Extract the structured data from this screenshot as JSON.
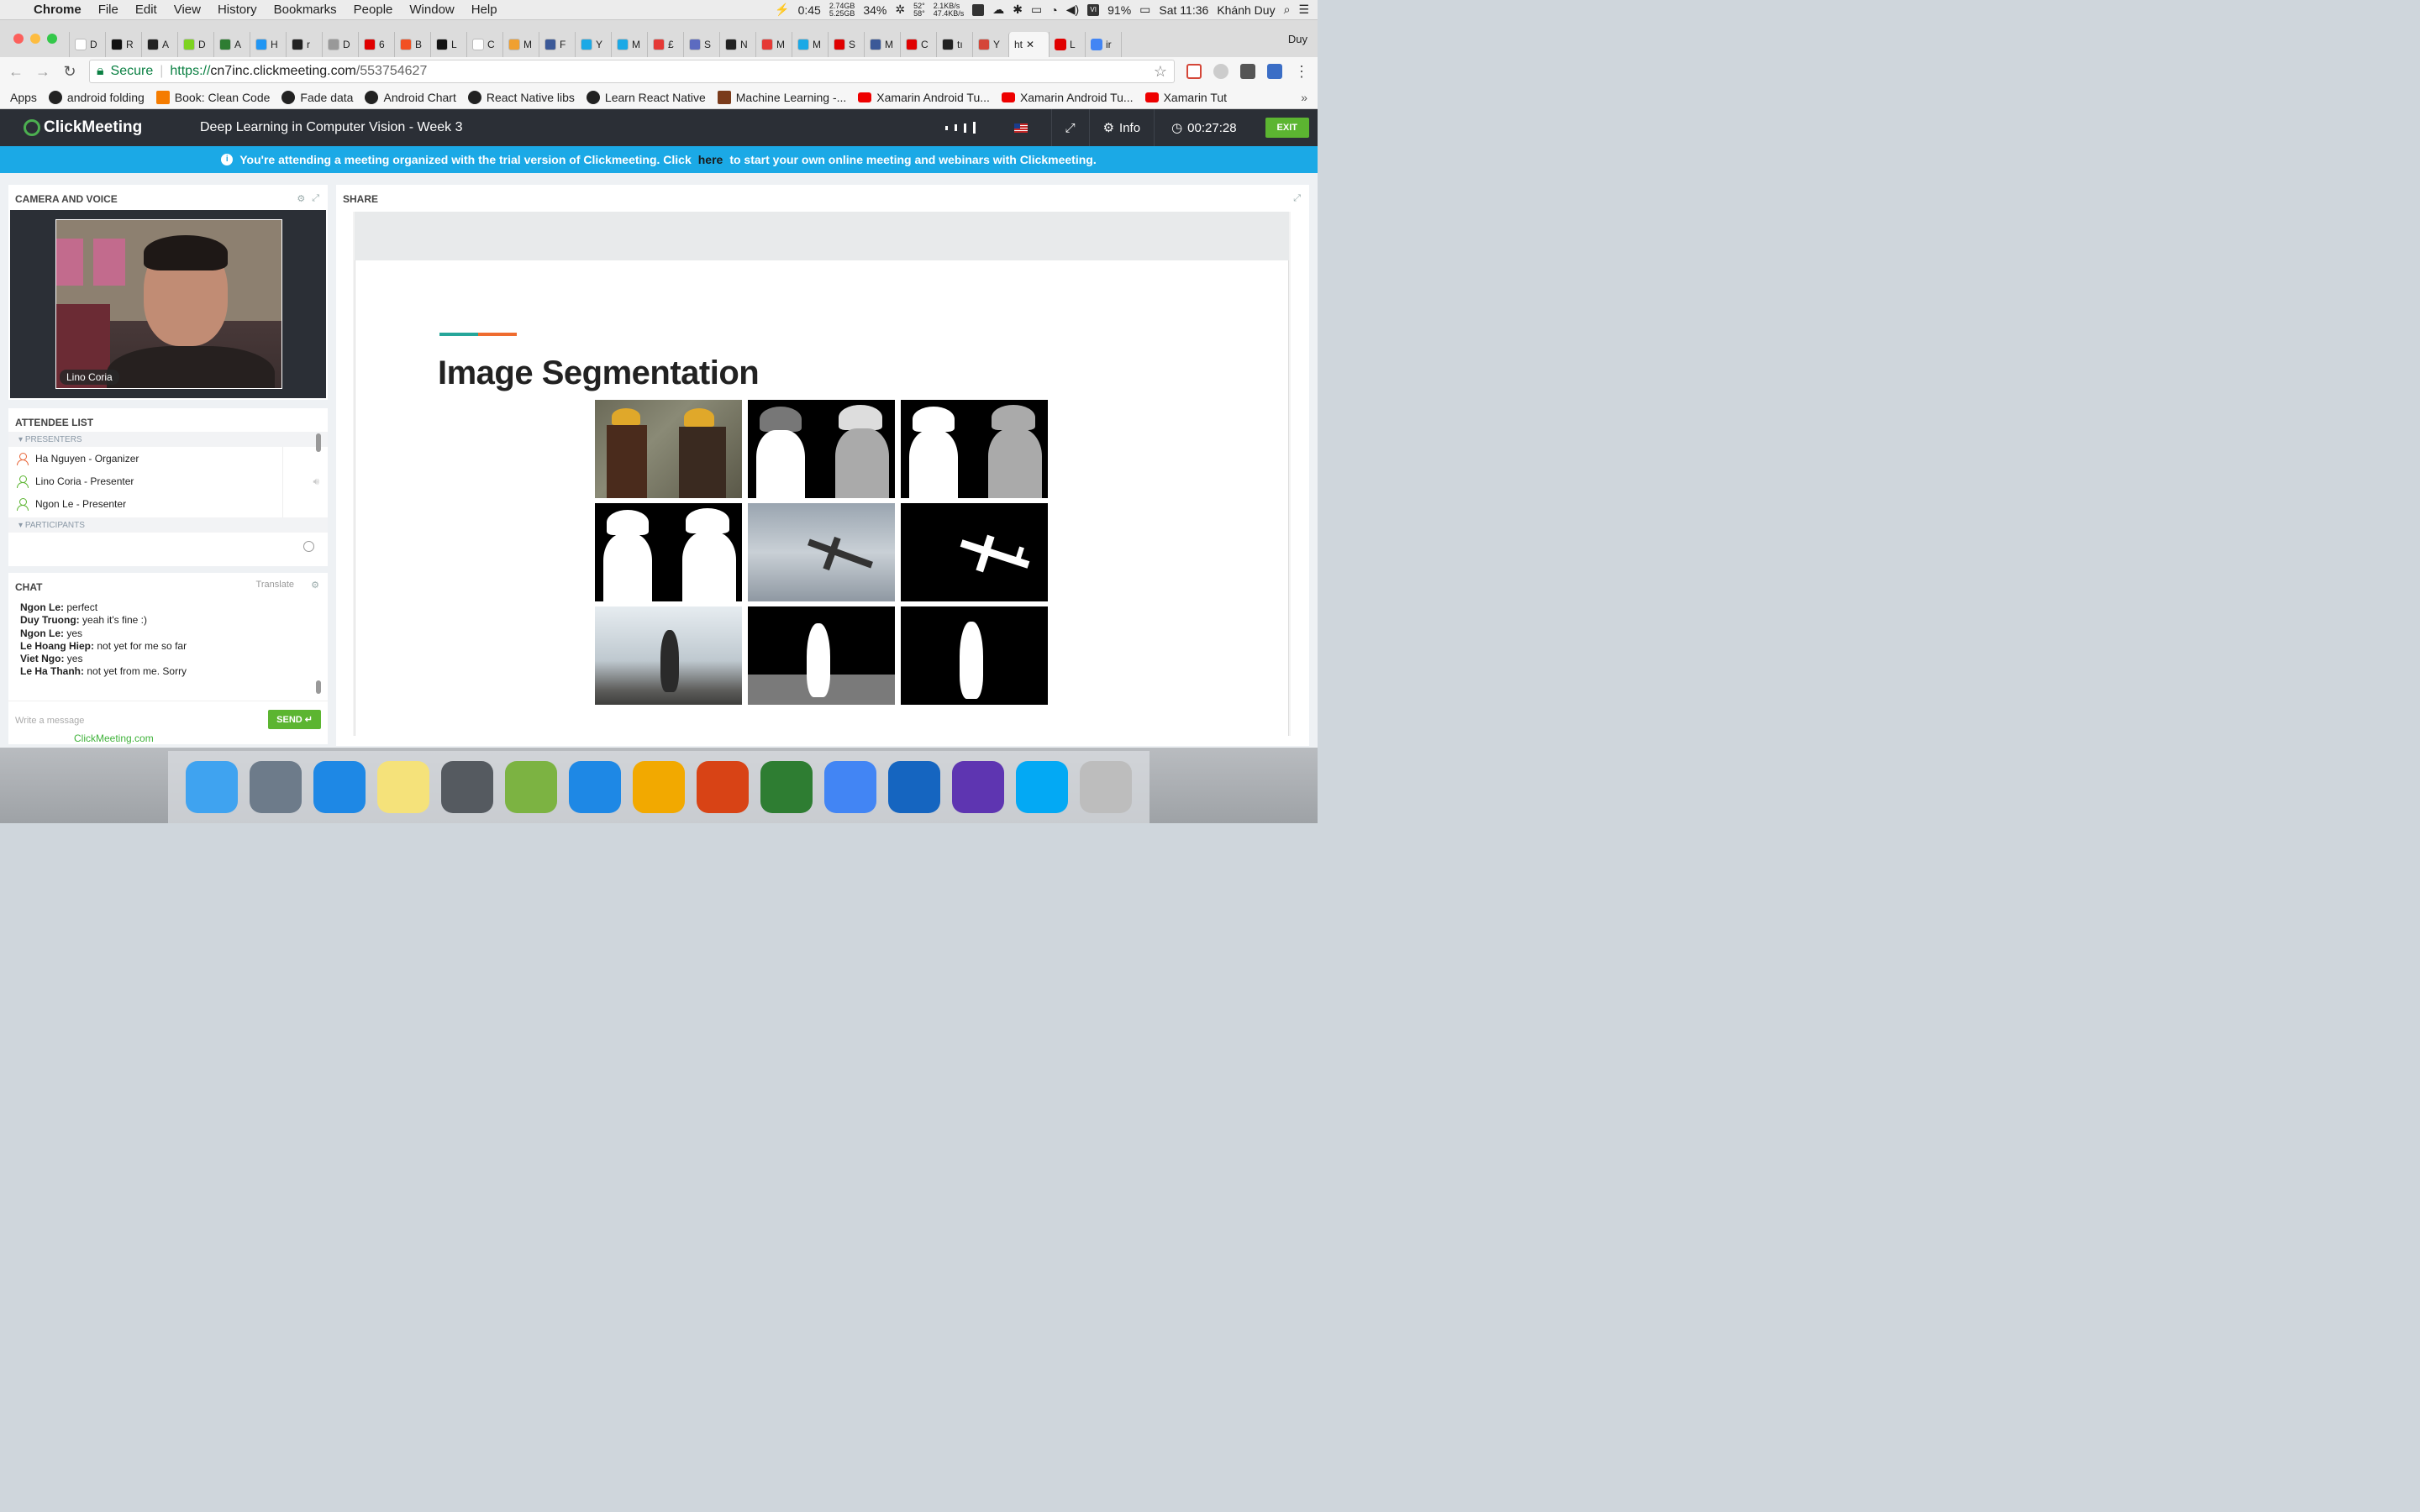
{
  "menubar": {
    "app": "Chrome",
    "items": [
      "File",
      "Edit",
      "View",
      "History",
      "Bookmarks",
      "People",
      "Window",
      "Help"
    ],
    "timer": "0:45",
    "mem_top": "2.74GB",
    "mem_bottom": "5.25GB",
    "cpu": "34%",
    "temp_top": "52°",
    "temp_bottom": "58°",
    "net_up": "2.1KB/s",
    "net_down": "47.4KB/s",
    "battery": "91%",
    "clock": "Sat 11:36",
    "user": "Khánh Duy"
  },
  "tabs": {
    "items": [
      {
        "letter": "D",
        "color": "#ffffff"
      },
      {
        "letter": "R",
        "color": "#111111"
      },
      {
        "letter": "A",
        "color": "#222222"
      },
      {
        "letter": "D",
        "color": "#7ed321"
      },
      {
        "letter": "A",
        "color": "#2e7d32"
      },
      {
        "letter": "H",
        "color": "#2196f3"
      },
      {
        "letter": "r",
        "color": "#222222"
      },
      {
        "letter": "D",
        "color": "#999999"
      },
      {
        "letter": "6",
        "color": "#e00000"
      },
      {
        "letter": "B",
        "color": "#f25022"
      },
      {
        "letter": "L",
        "color": "#111111"
      },
      {
        "letter": "C",
        "color": "#ffffff"
      },
      {
        "letter": "M",
        "color": "#f0a030"
      },
      {
        "letter": "F",
        "color": "#3b5998"
      },
      {
        "letter": "Y",
        "color": "#1ba9e6"
      },
      {
        "letter": "M",
        "color": "#1ba9e6"
      },
      {
        "letter": "£",
        "color": "#e53935"
      },
      {
        "letter": "S",
        "color": "#5c6bc0"
      },
      {
        "letter": "N",
        "color": "#222222"
      },
      {
        "letter": "M",
        "color": "#e53935"
      },
      {
        "letter": "M",
        "color": "#1ba9e6"
      },
      {
        "letter": "S",
        "color": "#e00000"
      },
      {
        "letter": "M",
        "color": "#3b5998"
      },
      {
        "letter": "C",
        "color": "#e00000"
      },
      {
        "letter": "tı",
        "color": "#222222"
      },
      {
        "letter": "Y",
        "color": "#d44638"
      }
    ],
    "active_label": "ht",
    "after_active": [
      {
        "letter": "L",
        "color": "#e00000"
      },
      {
        "letter": "ir",
        "color": "#4285f4"
      }
    ],
    "profile": "Duy"
  },
  "address": {
    "secure_label": "Secure",
    "scheme": "https://",
    "host": "cn7inc.clickmeeting.com",
    "path": "/553754627"
  },
  "bookmarks": [
    {
      "label": "Apps",
      "icon": "apps-grid-icon"
    },
    {
      "label": "android folding",
      "icon": "github-icon"
    },
    {
      "label": "Book: Clean Code",
      "icon": "blogger-icon"
    },
    {
      "label": "Fade data",
      "icon": "github-icon"
    },
    {
      "label": "Android Chart",
      "icon": "github-icon"
    },
    {
      "label": "React Native libs",
      "icon": "github-icon"
    },
    {
      "label": "Learn React Native",
      "icon": "github-icon"
    },
    {
      "label": "Machine Learning -...",
      "icon": "site-icon"
    },
    {
      "label": "Xamarin Android Tu...",
      "icon": "youtube-icon"
    },
    {
      "label": "Xamarin Android Tu...",
      "icon": "youtube-icon"
    },
    {
      "label": "Xamarin Tut",
      "icon": "youtube-icon"
    }
  ],
  "header": {
    "logo": "ClickMeeting",
    "title": "Deep Learning in Computer Vision - Week 3",
    "info_label": "Info",
    "timer": "00:27:28",
    "exit_label": "EXIT"
  },
  "banner": {
    "before": "You're attending a meeting organized with the trial version of Clickmeeting. Click",
    "link": "here",
    "after": "to start your own online meeting and webinars with Clickmeeting."
  },
  "camera": {
    "title": "CAMERA AND VOICE",
    "presenter_name": "Lino Coria"
  },
  "attendees": {
    "title": "ATTENDEE LIST",
    "presenters_label": "PRESENTERS",
    "participants_label": "PARTICIPANTS",
    "people": [
      {
        "name": "Ha Nguyen - Organizer",
        "color": "#e8673a"
      },
      {
        "name": "Lino Coria - Presenter",
        "color": "#5cb531"
      },
      {
        "name": "Ngon Le - Presenter",
        "color": "#5cb531"
      }
    ]
  },
  "chat": {
    "title": "CHAT",
    "translate_label": "Translate",
    "messages": [
      {
        "author": "Ngon Le:",
        "text": "perfect"
      },
      {
        "author": "Duy Truong:",
        "text": "yeah it's fine :)"
      },
      {
        "author": "Ngon Le:",
        "text": "yes"
      },
      {
        "author": "Le Hoang Hiep:",
        "text": "not yet for me so far"
      },
      {
        "author": "Viet Ngo:",
        "text": "yes"
      },
      {
        "author": "Le Ha Thanh:",
        "text": "not yet from me. Sorry"
      }
    ],
    "input_placeholder": "Write a message",
    "send_label": "SEND",
    "powered_by": "ClickMeeting.com"
  },
  "share": {
    "title": "SHARE",
    "slide_title": "Image Segmentation"
  }
}
